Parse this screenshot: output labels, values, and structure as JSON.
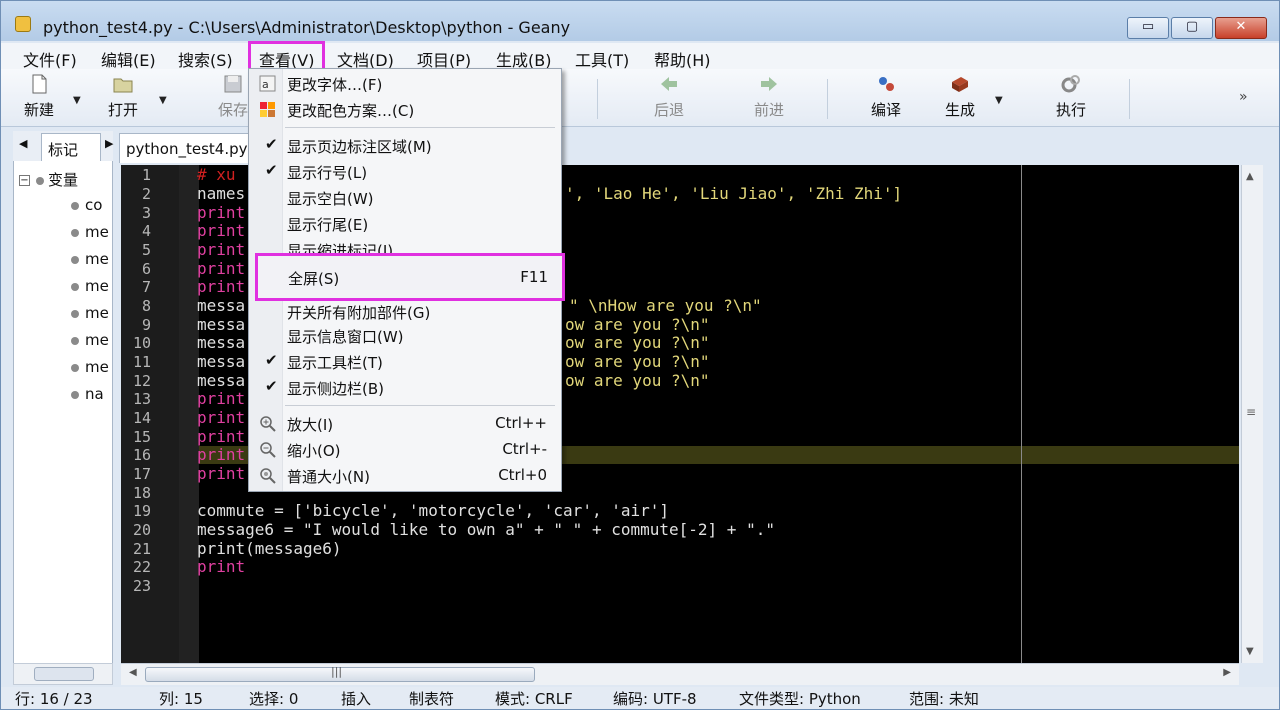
{
  "window": {
    "title": "python_test4.py - C:\\Users\\Administrator\\Desktop\\python - Geany",
    "min_glyph": "▭",
    "max_glyph": "▢",
    "close_glyph": "✕"
  },
  "menubar": [
    {
      "label": "文件(F)"
    },
    {
      "label": "编辑(E)"
    },
    {
      "label": "搜索(S)"
    },
    {
      "label": "查看(V)"
    },
    {
      "label": "文档(D)"
    },
    {
      "label": "项目(P)"
    },
    {
      "label": "生成(B)"
    },
    {
      "label": "工具(T)"
    },
    {
      "label": "帮助(H)"
    }
  ],
  "toolbar": {
    "new": "新建",
    "open": "打开",
    "save": "保存",
    "back": "后退",
    "forward": "前进",
    "compile": "编译",
    "build": "生成",
    "execute": "执行",
    "overflow": "»"
  },
  "sidebar": {
    "tab": "标记",
    "root": "变量",
    "items": [
      "co",
      "me",
      "me",
      "me",
      "me",
      "me",
      "me",
      "na"
    ]
  },
  "document_tab": "python_test4.py",
  "code": {
    "line_numbers": [
      "1",
      "2",
      "3",
      "4",
      "5",
      "6",
      "7",
      "8",
      "9",
      "10",
      "11",
      "12",
      "13",
      "14",
      "15",
      "16",
      "17",
      "18",
      "19",
      "20",
      "21",
      "22",
      "23"
    ],
    "visible_fragments": {
      "l1": "# xu",
      "l2a": "names",
      "l2b": "', 'Lao He', 'Liu Jiao', 'Zhi Zhi']",
      "print": "print",
      "mess": "messa",
      "l8b": "\" \\nHow are you ?\\n\"",
      "ow": "ow are you ?\\n\"",
      "l19": "commute = ['bicycle', 'motorcycle', 'car', 'air']",
      "l20": "message6 = \"I would like to own a\" + \" \" + commute[-2] + \".\"",
      "l21": "print(message6)",
      "l22": "print"
    }
  },
  "view_menu": {
    "change_font": "更改字体…(F)",
    "change_color": "更改配色方案…(C)",
    "show_margin": "显示页边标注区域(M)",
    "show_line_numbers": "显示行号(L)",
    "show_whitespace": "显示空白(W)",
    "show_line_endings": "显示行尾(E)",
    "show_indent_guides": "显示缩进标记(I)",
    "fullscreen": "全屏(S)",
    "fullscreen_accel": "F11",
    "toggle_addons": "开关所有附加部件(G)",
    "show_messages": "显示信息窗口(W)",
    "show_toolbar": "显示工具栏(T)",
    "show_sidebar": "显示侧边栏(B)",
    "zoom_in": "放大(I)",
    "zoom_in_accel": "Ctrl++",
    "zoom_out": "缩小(O)",
    "zoom_out_accel": "Ctrl+-",
    "zoom_reset": "普通大小(N)",
    "zoom_reset_accel": "Ctrl+0",
    "check": "✔"
  },
  "status": {
    "line": "行: 16 / 23",
    "col": "列: 15",
    "sel": "选择: 0",
    "ins": "插入",
    "tab": "制表符",
    "mode": "模式: CRLF",
    "enc": "编码: UTF-8",
    "type": "文件类型: Python",
    "scope": "范围: 未知"
  },
  "colors": {
    "highlight_box": "#e030e0",
    "editor_bg": "#000000",
    "keyword": "#e040a0",
    "string": "#e2d77a"
  }
}
